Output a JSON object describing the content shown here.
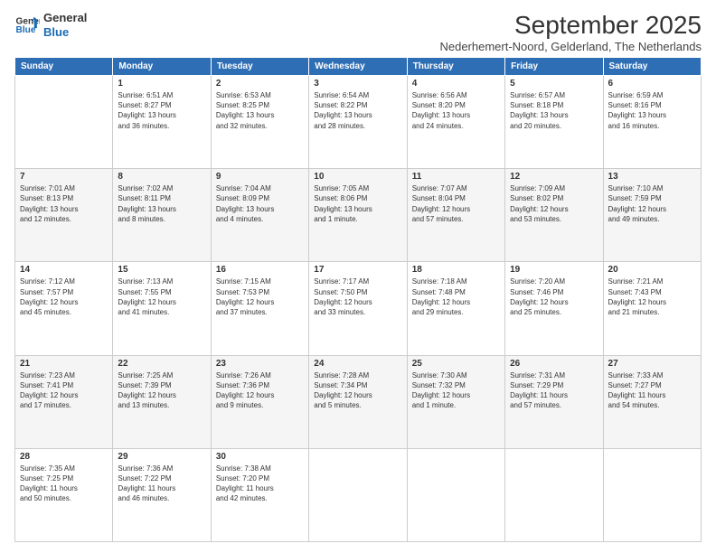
{
  "logo": {
    "line1": "General",
    "line2": "Blue"
  },
  "title": "September 2025",
  "subtitle": "Nederhemert-Noord, Gelderland, The Netherlands",
  "weekdays": [
    "Sunday",
    "Monday",
    "Tuesday",
    "Wednesday",
    "Thursday",
    "Friday",
    "Saturday"
  ],
  "weeks": [
    [
      {
        "day": "",
        "info": ""
      },
      {
        "day": "1",
        "info": "Sunrise: 6:51 AM\nSunset: 8:27 PM\nDaylight: 13 hours\nand 36 minutes."
      },
      {
        "day": "2",
        "info": "Sunrise: 6:53 AM\nSunset: 8:25 PM\nDaylight: 13 hours\nand 32 minutes."
      },
      {
        "day": "3",
        "info": "Sunrise: 6:54 AM\nSunset: 8:22 PM\nDaylight: 13 hours\nand 28 minutes."
      },
      {
        "day": "4",
        "info": "Sunrise: 6:56 AM\nSunset: 8:20 PM\nDaylight: 13 hours\nand 24 minutes."
      },
      {
        "day": "5",
        "info": "Sunrise: 6:57 AM\nSunset: 8:18 PM\nDaylight: 13 hours\nand 20 minutes."
      },
      {
        "day": "6",
        "info": "Sunrise: 6:59 AM\nSunset: 8:16 PM\nDaylight: 13 hours\nand 16 minutes."
      }
    ],
    [
      {
        "day": "7",
        "info": "Sunrise: 7:01 AM\nSunset: 8:13 PM\nDaylight: 13 hours\nand 12 minutes."
      },
      {
        "day": "8",
        "info": "Sunrise: 7:02 AM\nSunset: 8:11 PM\nDaylight: 13 hours\nand 8 minutes."
      },
      {
        "day": "9",
        "info": "Sunrise: 7:04 AM\nSunset: 8:09 PM\nDaylight: 13 hours\nand 4 minutes."
      },
      {
        "day": "10",
        "info": "Sunrise: 7:05 AM\nSunset: 8:06 PM\nDaylight: 13 hours\nand 1 minute."
      },
      {
        "day": "11",
        "info": "Sunrise: 7:07 AM\nSunset: 8:04 PM\nDaylight: 12 hours\nand 57 minutes."
      },
      {
        "day": "12",
        "info": "Sunrise: 7:09 AM\nSunset: 8:02 PM\nDaylight: 12 hours\nand 53 minutes."
      },
      {
        "day": "13",
        "info": "Sunrise: 7:10 AM\nSunset: 7:59 PM\nDaylight: 12 hours\nand 49 minutes."
      }
    ],
    [
      {
        "day": "14",
        "info": "Sunrise: 7:12 AM\nSunset: 7:57 PM\nDaylight: 12 hours\nand 45 minutes."
      },
      {
        "day": "15",
        "info": "Sunrise: 7:13 AM\nSunset: 7:55 PM\nDaylight: 12 hours\nand 41 minutes."
      },
      {
        "day": "16",
        "info": "Sunrise: 7:15 AM\nSunset: 7:53 PM\nDaylight: 12 hours\nand 37 minutes."
      },
      {
        "day": "17",
        "info": "Sunrise: 7:17 AM\nSunset: 7:50 PM\nDaylight: 12 hours\nand 33 minutes."
      },
      {
        "day": "18",
        "info": "Sunrise: 7:18 AM\nSunset: 7:48 PM\nDaylight: 12 hours\nand 29 minutes."
      },
      {
        "day": "19",
        "info": "Sunrise: 7:20 AM\nSunset: 7:46 PM\nDaylight: 12 hours\nand 25 minutes."
      },
      {
        "day": "20",
        "info": "Sunrise: 7:21 AM\nSunset: 7:43 PM\nDaylight: 12 hours\nand 21 minutes."
      }
    ],
    [
      {
        "day": "21",
        "info": "Sunrise: 7:23 AM\nSunset: 7:41 PM\nDaylight: 12 hours\nand 17 minutes."
      },
      {
        "day": "22",
        "info": "Sunrise: 7:25 AM\nSunset: 7:39 PM\nDaylight: 12 hours\nand 13 minutes."
      },
      {
        "day": "23",
        "info": "Sunrise: 7:26 AM\nSunset: 7:36 PM\nDaylight: 12 hours\nand 9 minutes."
      },
      {
        "day": "24",
        "info": "Sunrise: 7:28 AM\nSunset: 7:34 PM\nDaylight: 12 hours\nand 5 minutes."
      },
      {
        "day": "25",
        "info": "Sunrise: 7:30 AM\nSunset: 7:32 PM\nDaylight: 12 hours\nand 1 minute."
      },
      {
        "day": "26",
        "info": "Sunrise: 7:31 AM\nSunset: 7:29 PM\nDaylight: 11 hours\nand 57 minutes."
      },
      {
        "day": "27",
        "info": "Sunrise: 7:33 AM\nSunset: 7:27 PM\nDaylight: 11 hours\nand 54 minutes."
      }
    ],
    [
      {
        "day": "28",
        "info": "Sunrise: 7:35 AM\nSunset: 7:25 PM\nDaylight: 11 hours\nand 50 minutes."
      },
      {
        "day": "29",
        "info": "Sunrise: 7:36 AM\nSunset: 7:22 PM\nDaylight: 11 hours\nand 46 minutes."
      },
      {
        "day": "30",
        "info": "Sunrise: 7:38 AM\nSunset: 7:20 PM\nDaylight: 11 hours\nand 42 minutes."
      },
      {
        "day": "",
        "info": ""
      },
      {
        "day": "",
        "info": ""
      },
      {
        "day": "",
        "info": ""
      },
      {
        "day": "",
        "info": ""
      }
    ]
  ]
}
